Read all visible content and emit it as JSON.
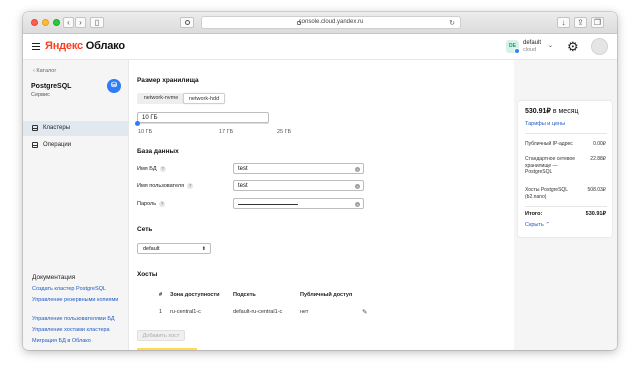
{
  "browser": {
    "url": "console.cloud.yandex.ru"
  },
  "header": {
    "logo_prefix": "Яндекс",
    "logo_suffix": " Облако",
    "cloud_avatar": "DE",
    "cloud_name": "default",
    "cloud_sub": "cloud"
  },
  "sidebar": {
    "back": "Каталог",
    "service_title": "PostgreSQL",
    "service_sub": "Сервис",
    "items": [
      {
        "label": "Кластеры"
      },
      {
        "label": "Операции"
      }
    ],
    "docs_title": "Документация",
    "docs": [
      "Создать кластер PostgreSQL",
      "Управление резервными копиями",
      "Управление пользователями БД",
      "Управление хостами кластера",
      "Миграция БД в Облако"
    ]
  },
  "storage": {
    "title": "Размер хранилища",
    "types": [
      "network-nvme",
      "network-hdd"
    ],
    "selected_type": "network-hdd",
    "size_value": "10 ГБ",
    "ticks": [
      "10 ГБ",
      "17 ГБ",
      "25 ГБ"
    ]
  },
  "database": {
    "title": "База данных",
    "db_name_label": "Имя БД",
    "db_name_value": "test",
    "user_label": "Имя пользователя",
    "user_value": "test",
    "password_label": "Пароль",
    "help": "?"
  },
  "network": {
    "title": "Сеть",
    "selected": "default"
  },
  "hosts": {
    "title": "Хосты",
    "columns": [
      "#",
      "Зона доступности",
      "Подсеть",
      "Публичный доступ"
    ],
    "rows": [
      {
        "num": "1",
        "zone": "ru-central1-c",
        "subnet": "default-ru-central1-c",
        "public": "нет"
      }
    ],
    "add_button": "Добавить хост"
  },
  "price": {
    "total_amount": "530.91₽",
    "total_suffix": " в месяц",
    "tariff_link": "Тарифы и цены",
    "lines": [
      {
        "label": "Публичный IP-адрес",
        "value": "0.00₽"
      },
      {
        "label": "Стандартное сетевое хранилище — PostgreSQL",
        "value": "22.88₽"
      },
      {
        "label": "Хосты PostgreSQL (b2.nano)",
        "value": "508.03₽"
      }
    ],
    "total_label": "Итого:",
    "total_value": "530.91₽",
    "hide_link": "Скрыть"
  }
}
